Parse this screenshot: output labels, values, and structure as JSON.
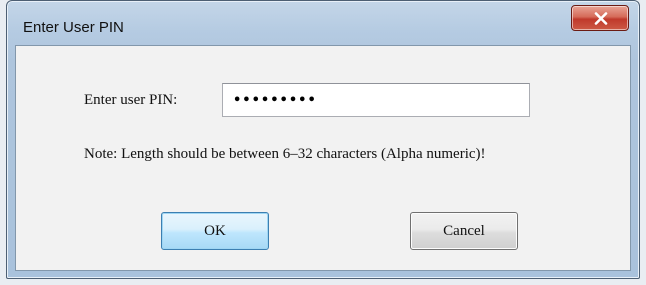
{
  "dialog": {
    "title": "Enter User PIN",
    "close_icon": "close-x-icon"
  },
  "form": {
    "pin_label": "Enter user PIN:",
    "pin_value": "•••••••••",
    "note": "Note: Length should be between 6–32 characters (Alpha numeric)!"
  },
  "buttons": {
    "ok_label": "OK",
    "cancel_label": "Cancel"
  },
  "colors": {
    "titlebar": "#b5cbe2",
    "close_button": "#c0392b",
    "ok_button_border": "#3c7fb1"
  }
}
